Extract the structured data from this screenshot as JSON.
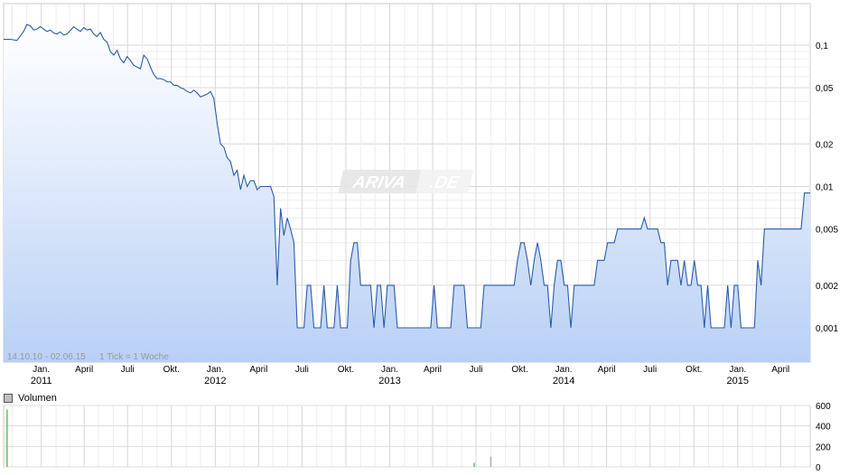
{
  "watermark": {
    "left": "ARIVA",
    "right": ".DE"
  },
  "footer": {
    "range": "14.10.10 - 02.06.15",
    "tick": "1 Tick = 1 Woche"
  },
  "volume_panel": {
    "legend": "Volumen"
  },
  "chart_data": [
    {
      "type": "area",
      "scale": "log",
      "ylim": [
        0.0006,
        0.17
      ],
      "y_ticks": [
        {
          "value": 0.1,
          "label": "0,1"
        },
        {
          "value": 0.05,
          "label": "0,05"
        },
        {
          "value": 0.02,
          "label": "0,02"
        },
        {
          "value": 0.01,
          "label": "0,01"
        },
        {
          "value": 0.005,
          "label": "0,005"
        },
        {
          "value": 0.002,
          "label": "0,002"
        },
        {
          "value": 0.001,
          "label": "0,001"
        }
      ],
      "y_minor": [
        0.09,
        0.08,
        0.07,
        0.06,
        0.04,
        0.03,
        0.009,
        0.008,
        0.007,
        0.006,
        0.004,
        0.003,
        0.0009,
        0.0008,
        0.0007
      ],
      "x_ticks": [
        {
          "label": "Jan.",
          "year": "2011"
        },
        {
          "label": "April",
          "year": ""
        },
        {
          "label": "Juli",
          "year": ""
        },
        {
          "label": "Okt.",
          "year": ""
        },
        {
          "label": "Jan.",
          "year": "2012"
        },
        {
          "label": "April",
          "year": ""
        },
        {
          "label": "Juli",
          "year": ""
        },
        {
          "label": "Okt.",
          "year": ""
        },
        {
          "label": "Jan.",
          "year": "2013"
        },
        {
          "label": "April",
          "year": ""
        },
        {
          "label": "Juli",
          "year": ""
        },
        {
          "label": "Okt.",
          "year": ""
        },
        {
          "label": "Jan.",
          "year": "2014"
        },
        {
          "label": "April",
          "year": ""
        },
        {
          "label": "Juli",
          "year": ""
        },
        {
          "label": "Okt.",
          "year": ""
        },
        {
          "label": "Jan.",
          "year": "2015"
        },
        {
          "label": "April",
          "year": ""
        }
      ],
      "x_range": [
        "2010-10-14",
        "2015-06-02"
      ],
      "series": [
        {
          "points": [
            [
              "2010-10-14",
              0.11
            ],
            [
              "2010-10-28",
              0.11
            ],
            [
              "2010-11-11",
              0.108
            ],
            [
              "2010-11-25",
              0.125
            ],
            [
              "2010-12-02",
              0.14
            ],
            [
              "2010-12-09",
              0.137
            ],
            [
              "2010-12-16",
              0.128
            ],
            [
              "2010-12-23",
              0.13
            ],
            [
              "2010-12-30",
              0.135
            ],
            [
              "2011-01-06",
              0.13
            ],
            [
              "2011-01-13",
              0.125
            ],
            [
              "2011-01-20",
              0.128
            ],
            [
              "2011-01-27",
              0.122
            ],
            [
              "2011-02-03",
              0.12
            ],
            [
              "2011-02-10",
              0.124
            ],
            [
              "2011-02-17",
              0.118
            ],
            [
              "2011-02-24",
              0.12
            ],
            [
              "2011-03-03",
              0.127
            ],
            [
              "2011-03-10",
              0.135
            ],
            [
              "2011-03-17",
              0.13
            ],
            [
              "2011-03-24",
              0.125
            ],
            [
              "2011-03-31",
              0.133
            ],
            [
              "2011-04-07",
              0.128
            ],
            [
              "2011-04-14",
              0.13
            ],
            [
              "2011-04-21",
              0.12
            ],
            [
              "2011-04-28",
              0.115
            ],
            [
              "2011-05-05",
              0.123
            ],
            [
              "2011-05-12",
              0.11
            ],
            [
              "2011-05-19",
              0.105
            ],
            [
              "2011-05-26",
              0.09
            ],
            [
              "2011-06-02",
              0.085
            ],
            [
              "2011-06-09",
              0.092
            ],
            [
              "2011-06-16",
              0.08
            ],
            [
              "2011-06-23",
              0.075
            ],
            [
              "2011-06-30",
              0.083
            ],
            [
              "2011-07-07",
              0.078
            ],
            [
              "2011-07-14",
              0.072
            ],
            [
              "2011-07-21",
              0.07
            ],
            [
              "2011-07-28",
              0.068
            ],
            [
              "2011-08-04",
              0.085
            ],
            [
              "2011-08-11",
              0.08
            ],
            [
              "2011-08-18",
              0.07
            ],
            [
              "2011-08-25",
              0.062
            ],
            [
              "2011-09-01",
              0.058
            ],
            [
              "2011-09-08",
              0.058
            ],
            [
              "2011-09-15",
              0.057
            ],
            [
              "2011-09-22",
              0.055
            ],
            [
              "2011-09-29",
              0.055
            ],
            [
              "2011-10-06",
              0.052
            ],
            [
              "2011-10-13",
              0.052
            ],
            [
              "2011-10-20",
              0.05
            ],
            [
              "2011-10-27",
              0.049
            ],
            [
              "2011-11-03",
              0.047
            ],
            [
              "2011-11-10",
              0.046
            ],
            [
              "2011-11-17",
              0.048
            ],
            [
              "2011-11-24",
              0.046
            ],
            [
              "2011-12-01",
              0.043
            ],
            [
              "2011-12-08",
              0.044
            ],
            [
              "2011-12-15",
              0.045
            ],
            [
              "2011-12-22",
              0.047
            ],
            [
              "2011-12-29",
              0.042
            ],
            [
              "2012-01-05",
              0.028
            ],
            [
              "2012-01-12",
              0.02
            ],
            [
              "2012-01-19",
              0.019
            ],
            [
              "2012-01-26",
              0.016
            ],
            [
              "2012-02-02",
              0.015
            ],
            [
              "2012-02-09",
              0.012
            ],
            [
              "2012-02-16",
              0.013
            ],
            [
              "2012-02-23",
              0.0095
            ],
            [
              "2012-03-01",
              0.012
            ],
            [
              "2012-03-08",
              0.01
            ],
            [
              "2012-03-15",
              0.011
            ],
            [
              "2012-03-22",
              0.011
            ],
            [
              "2012-03-29",
              0.0095
            ],
            [
              "2012-04-05",
              0.01
            ],
            [
              "2012-04-12",
              0.01
            ],
            [
              "2012-04-19",
              0.01
            ],
            [
              "2012-04-26",
              0.01
            ],
            [
              "2012-05-03",
              0.0085
            ],
            [
              "2012-05-10",
              0.002
            ],
            [
              "2012-05-17",
              0.007
            ],
            [
              "2012-05-24",
              0.0045
            ],
            [
              "2012-05-31",
              0.006
            ],
            [
              "2012-06-07",
              0.005
            ],
            [
              "2012-06-14",
              0.004
            ],
            [
              "2012-06-21",
              0.001
            ],
            [
              "2012-07-05",
              0.001
            ],
            [
              "2012-07-12",
              0.002
            ],
            [
              "2012-07-19",
              0.002
            ],
            [
              "2012-07-26",
              0.001
            ],
            [
              "2012-08-09",
              0.001
            ],
            [
              "2012-08-16",
              0.002
            ],
            [
              "2012-08-23",
              0.001
            ],
            [
              "2012-09-06",
              0.001
            ],
            [
              "2012-09-13",
              0.002
            ],
            [
              "2012-09-20",
              0.001
            ],
            [
              "2012-10-04",
              0.001
            ],
            [
              "2012-10-11",
              0.003
            ],
            [
              "2012-10-18",
              0.004
            ],
            [
              "2012-10-25",
              0.004
            ],
            [
              "2012-11-01",
              0.002
            ],
            [
              "2012-11-22",
              0.002
            ],
            [
              "2012-11-29",
              0.001
            ],
            [
              "2012-12-06",
              0.002
            ],
            [
              "2012-12-13",
              0.002
            ],
            [
              "2012-12-20",
              0.001
            ],
            [
              "2012-12-27",
              0.002
            ],
            [
              "2013-01-03",
              0.002
            ],
            [
              "2013-01-10",
              0.002
            ],
            [
              "2013-01-17",
              0.001
            ],
            [
              "2013-03-28",
              0.001
            ],
            [
              "2013-04-04",
              0.002
            ],
            [
              "2013-04-11",
              0.001
            ],
            [
              "2013-05-09",
              0.001
            ],
            [
              "2013-05-16",
              0.002
            ],
            [
              "2013-06-06",
              0.002
            ],
            [
              "2013-06-13",
              0.001
            ],
            [
              "2013-07-11",
              0.001
            ],
            [
              "2013-07-18",
              0.002
            ],
            [
              "2013-09-19",
              0.002
            ],
            [
              "2013-09-26",
              0.003
            ],
            [
              "2013-10-03",
              0.004
            ],
            [
              "2013-10-10",
              0.004
            ],
            [
              "2013-10-17",
              0.003
            ],
            [
              "2013-10-24",
              0.002
            ],
            [
              "2013-10-31",
              0.003
            ],
            [
              "2013-11-07",
              0.004
            ],
            [
              "2013-11-14",
              0.003
            ],
            [
              "2013-11-21",
              0.002
            ],
            [
              "2013-11-28",
              0.002
            ],
            [
              "2013-12-05",
              0.001
            ],
            [
              "2013-12-12",
              0.002
            ],
            [
              "2013-12-19",
              0.003
            ],
            [
              "2013-12-26",
              0.003
            ],
            [
              "2014-01-02",
              0.002
            ],
            [
              "2014-01-09",
              0.002
            ],
            [
              "2014-01-16",
              0.001
            ],
            [
              "2014-01-23",
              0.002
            ],
            [
              "2014-03-06",
              0.002
            ],
            [
              "2014-03-13",
              0.003
            ],
            [
              "2014-03-27",
              0.003
            ],
            [
              "2014-04-03",
              0.004
            ],
            [
              "2014-04-17",
              0.004
            ],
            [
              "2014-04-24",
              0.005
            ],
            [
              "2014-06-12",
              0.005
            ],
            [
              "2014-06-19",
              0.006
            ],
            [
              "2014-06-26",
              0.005
            ],
            [
              "2014-07-17",
              0.005
            ],
            [
              "2014-07-24",
              0.004
            ],
            [
              "2014-07-31",
              0.004
            ],
            [
              "2014-08-07",
              0.002
            ],
            [
              "2014-08-14",
              0.003
            ],
            [
              "2014-08-28",
              0.003
            ],
            [
              "2014-09-04",
              0.002
            ],
            [
              "2014-09-11",
              0.003
            ],
            [
              "2014-09-18",
              0.002
            ],
            [
              "2014-09-25",
              0.002
            ],
            [
              "2014-10-02",
              0.003
            ],
            [
              "2014-10-09",
              0.002
            ],
            [
              "2014-10-16",
              0.002
            ],
            [
              "2014-10-23",
              0.001
            ],
            [
              "2014-10-30",
              0.002
            ],
            [
              "2014-11-06",
              0.001
            ],
            [
              "2014-12-04",
              0.001
            ],
            [
              "2014-12-11",
              0.002
            ],
            [
              "2014-12-18",
              0.001
            ],
            [
              "2014-12-25",
              0.002
            ],
            [
              "2015-01-01",
              0.002
            ],
            [
              "2015-01-08",
              0.001
            ],
            [
              "2015-02-05",
              0.001
            ],
            [
              "2015-02-12",
              0.003
            ],
            [
              "2015-02-19",
              0.002
            ],
            [
              "2015-02-26",
              0.005
            ],
            [
              "2015-05-14",
              0.005
            ],
            [
              "2015-05-21",
              0.009
            ],
            [
              "2015-06-02",
              0.009
            ]
          ]
        }
      ]
    },
    {
      "type": "bar",
      "ylim": [
        0,
        600
      ],
      "y_ticks": [
        {
          "value": 600,
          "label": "600"
        },
        {
          "value": 400,
          "label": "400"
        },
        {
          "value": 200,
          "label": "200"
        },
        {
          "value": 0,
          "label": "0"
        }
      ],
      "bars": [
        {
          "x": "2010-10-14",
          "value": 560,
          "color": "#66cc66"
        },
        {
          "x": "2013-06-20",
          "value": 40,
          "color": "#66cc66"
        },
        {
          "x": "2013-07-25",
          "value": 100,
          "color": "#b0b0b0"
        }
      ]
    }
  ]
}
